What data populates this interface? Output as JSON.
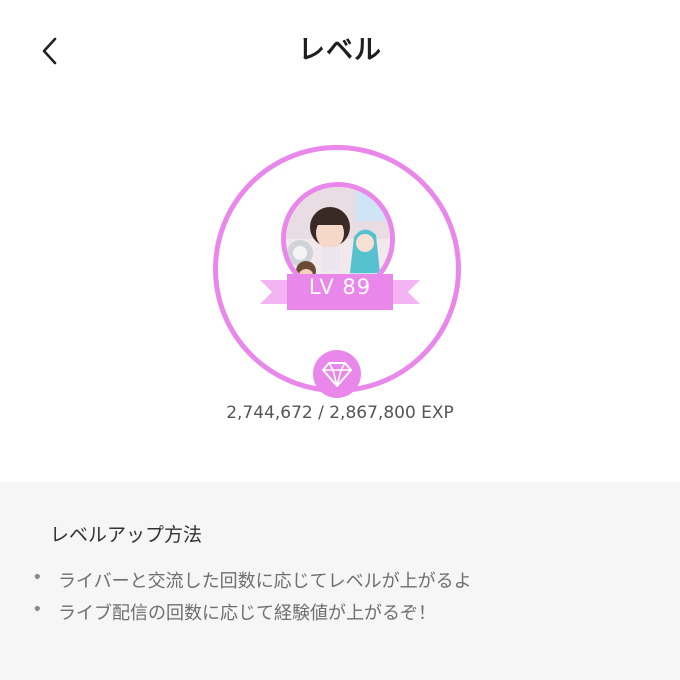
{
  "header": {
    "title": "レベル",
    "back_icon": "chevron-left-icon"
  },
  "level": {
    "label": "LV 89",
    "current_exp": "2,744,672",
    "max_exp": "2,867,800",
    "exp_text": "2,744,672 / 2,867,800 EXP",
    "badge_icon": "diamond-icon"
  },
  "info": {
    "heading": "レベルアップ方法",
    "items": [
      "ライバーと交流した回数に応じてレベルが上がるよ",
      "ライブ配信の回数に応じて経験値が上がるぞ！"
    ]
  },
  "colors": {
    "accent": "#e988ea",
    "ribbon_light": "#f4b4f3",
    "panel_bg": "#f6f6f6"
  }
}
